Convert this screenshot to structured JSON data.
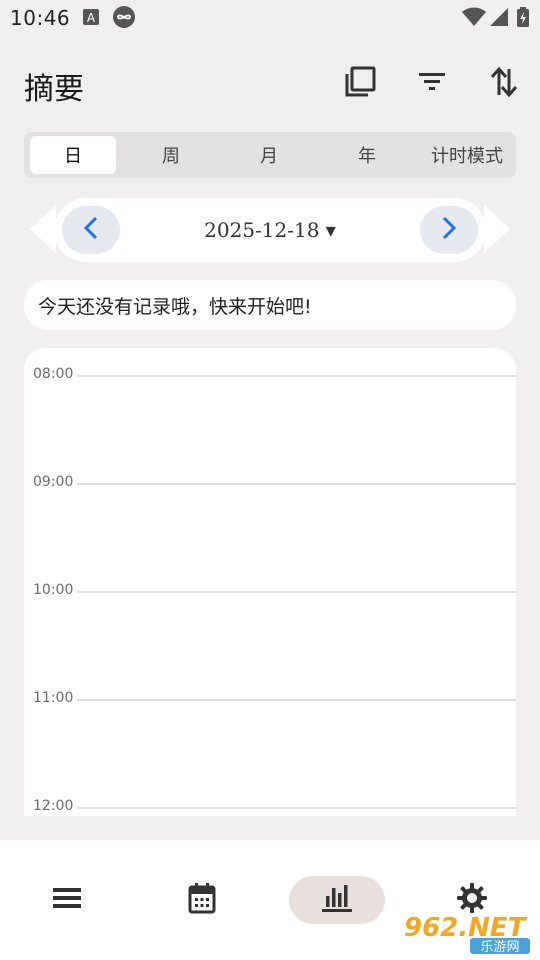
{
  "status_bar": {
    "time": "10:46",
    "icons": [
      "a-notification-icon",
      "infinity-icon",
      "wifi-icon",
      "signal-icon",
      "battery-charging-icon"
    ]
  },
  "header": {
    "title": "摘要",
    "actions": [
      "copy-icon",
      "filter-icon",
      "sort-icon"
    ]
  },
  "tabs": {
    "items": [
      "日",
      "周",
      "月",
      "年",
      "计时模式"
    ],
    "active": "日"
  },
  "date_nav": {
    "date": "2025-12-18 ▾",
    "accent": "#1a73e8"
  },
  "empty_message": "今天还没有记录哦，快来开始吧!",
  "timeline": {
    "hours": [
      "08:00",
      "09:00",
      "10:00",
      "11:00",
      "12:00"
    ]
  },
  "bottom_nav": {
    "items": [
      "list-icon",
      "calendar-icon",
      "bar-chart-icon",
      "settings-icon"
    ],
    "active": "bar-chart-icon"
  },
  "watermark": {
    "text_top": "962.NET",
    "text_bottom": "乐游网"
  }
}
